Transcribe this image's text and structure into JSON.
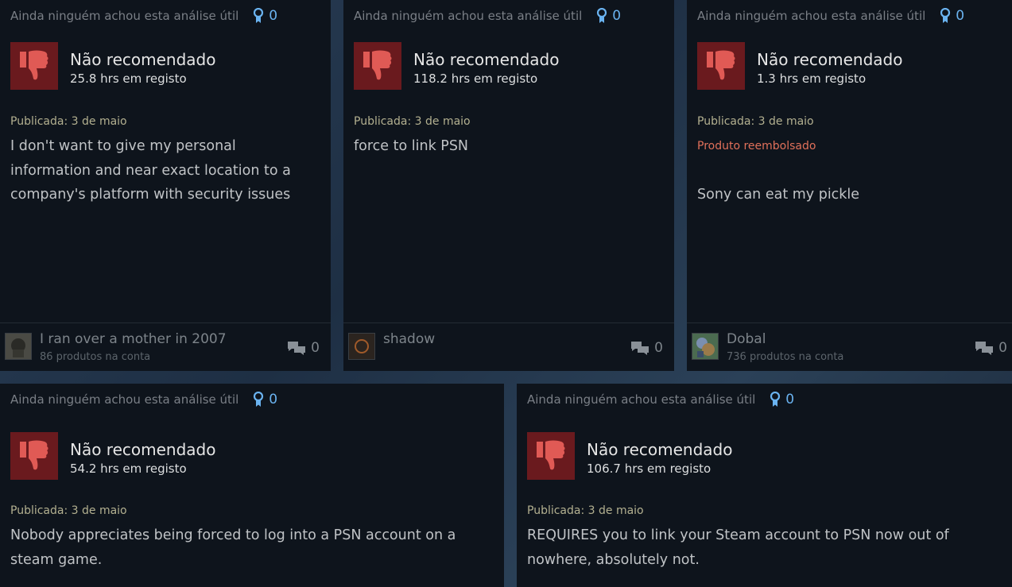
{
  "reviews": [
    {
      "helpful_text": "Ainda ninguém achou esta análise útil",
      "award_count": "0",
      "verdict": "Não recomendado",
      "hours": "25.8 hrs em registo",
      "posted": "Publicada: 3 de maio",
      "refunded": "",
      "body": "I don't want to give my personal information and near exact location to a company's platform with security issues",
      "user": "I ran over a mother in 2007",
      "products": "86 produtos na conta",
      "comments": "0"
    },
    {
      "helpful_text": "Ainda ninguém achou esta análise útil",
      "award_count": "0",
      "verdict": "Não recomendado",
      "hours": "118.2 hrs em registo",
      "posted": "Publicada: 3 de maio",
      "refunded": "",
      "body": "force to link PSN",
      "user": "shadow",
      "products": "",
      "comments": "0"
    },
    {
      "helpful_text": "Ainda ninguém achou esta análise útil",
      "award_count": "0",
      "verdict": "Não recomendado",
      "hours": "1.3 hrs em registo",
      "posted": "Publicada: 3 de maio",
      "refunded": "Produto reembolsado",
      "body": "Sony can eat my pickle",
      "user": "Dobal",
      "products": "736 produtos na conta",
      "comments": "0"
    },
    {
      "helpful_text": "Ainda ninguém achou esta análise útil",
      "award_count": "0",
      "verdict": "Não recomendado",
      "hours": "54.2 hrs em registo",
      "posted": "Publicada: 3 de maio",
      "refunded": "",
      "body": "Nobody appreciates being forced to log into a PSN account on a steam game."
    },
    {
      "helpful_text": "Ainda ninguém achou esta análise útil",
      "award_count": "0",
      "verdict": "Não recomendado",
      "hours": "106.7 hrs em registo",
      "posted": "Publicada: 3 de maio",
      "refunded": "",
      "body": "REQUIRES you to link your Steam account to PSN now out of nowhere, absolutely not."
    }
  ],
  "colors": {
    "card_bg": "#0e141c",
    "thumb_bg": "#6a1a1e",
    "thumb_icon": "#e05a55",
    "award_blue": "#6ab3f0",
    "refunded": "#e0705a"
  },
  "icons": {
    "award": "award-ribbon-icon",
    "verdict": "thumbs-down-icon",
    "comments": "comment-bubbles-icon"
  }
}
